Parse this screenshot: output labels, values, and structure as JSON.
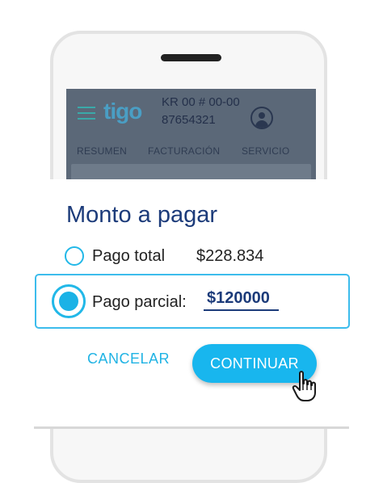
{
  "app": {
    "logo_text": "tigo",
    "account_line1": "KR 00 # 00-00",
    "account_line2": "87654321"
  },
  "tabs": [
    {
      "label": "RESUMEN"
    },
    {
      "label": "FACTURACIÓN"
    },
    {
      "label": "SERVICIO"
    }
  ],
  "dialog": {
    "title": "Monto a pagar",
    "options": {
      "total": {
        "label": "Pago total",
        "amount": "$228.834",
        "selected": false
      },
      "partial": {
        "label": "Pago parcial:",
        "amount_value": "$120000",
        "selected": true
      }
    },
    "cancel_label": "CANCELAR",
    "continue_label": "CONTINUAR"
  },
  "colors": {
    "accent": "#18b6ee",
    "title": "#1c3b7a",
    "screen_overlay": "#5b6878"
  },
  "icons": [
    "menu-icon",
    "user-avatar-icon",
    "hand-pointer-icon"
  ]
}
